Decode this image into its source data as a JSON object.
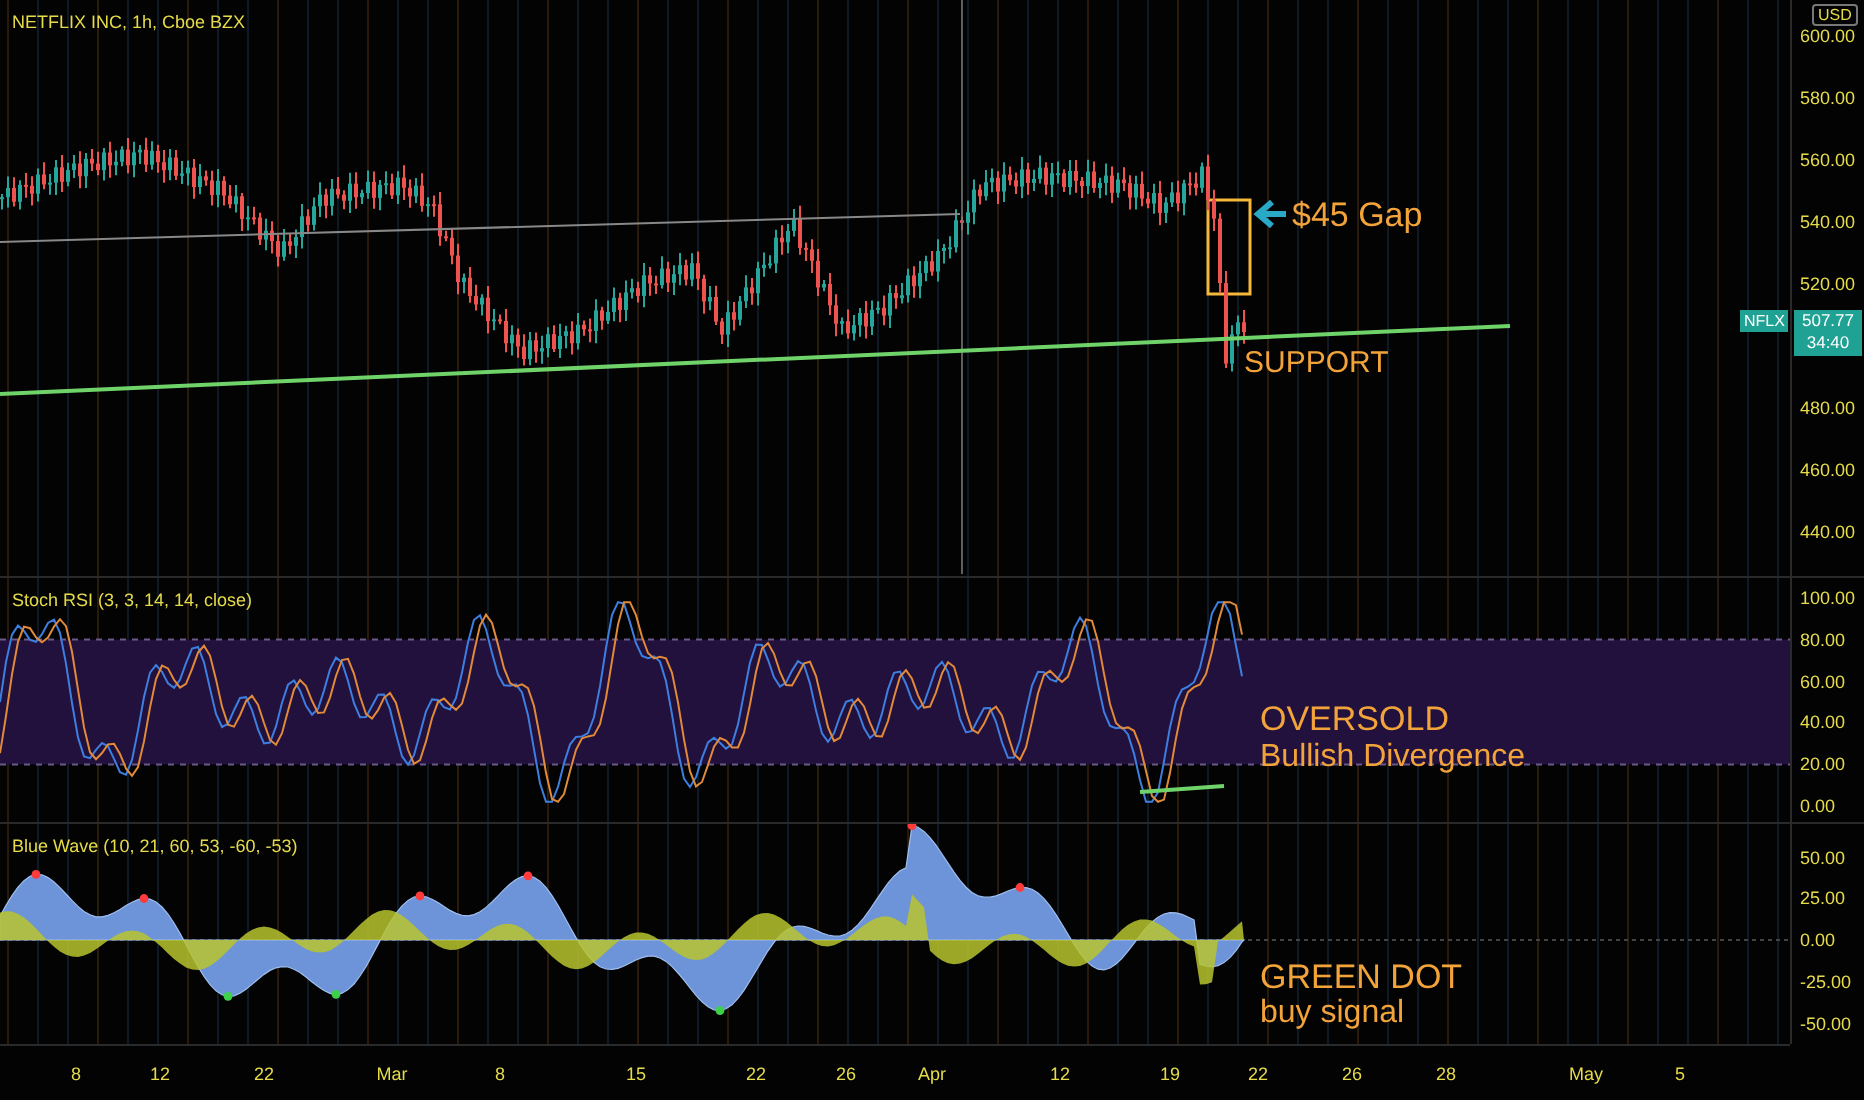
{
  "legend": {
    "title": "NETFLIX INC, 1h, Cboe BZX"
  },
  "price_axis": {
    "currency": "USD",
    "ticks": [
      "600.00",
      "580.00",
      "560.00",
      "540.00",
      "520.00",
      "480.00",
      "460.00",
      "440.00"
    ]
  },
  "price_tag": {
    "symbol": "NFLX",
    "price": "507.77",
    "countdown": "34:40"
  },
  "annotations": {
    "gap": "$45 Gap",
    "support": "SUPPORT"
  },
  "stoch_rsi": {
    "label": "Stoch RSI (3, 3, 14, 14, close)",
    "ticks": [
      "100.00",
      "80.00",
      "60.00",
      "40.00",
      "20.00",
      "0.00"
    ],
    "note_title": "OVERSOLD",
    "note_text": "Bullish Divergence"
  },
  "blue_wave": {
    "label": "Blue Wave (10, 21, 60, 53, -60, -53)",
    "ticks": [
      "50.00",
      "25.00",
      "0.00",
      "-25.00",
      "-50.00"
    ],
    "note_title": "GREEN DOT",
    "note_text": "buy signal"
  },
  "time_axis": {
    "labels": [
      "8",
      "12",
      "22",
      "Mar",
      "8",
      "15",
      "22",
      "26",
      "Apr",
      "12",
      "19",
      "22",
      "26",
      "28",
      "May",
      "5"
    ]
  }
}
